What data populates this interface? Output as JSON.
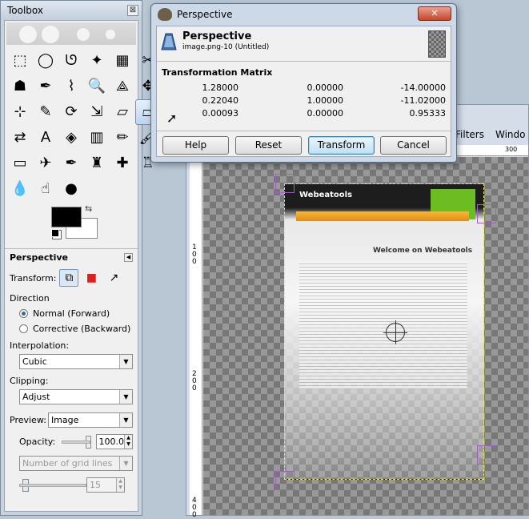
{
  "toolbox": {
    "title": "Toolbox",
    "close_glyph": "⊠",
    "tools": [
      {
        "name": "rect-select-icon",
        "glyph": "⬚"
      },
      {
        "name": "ellipse-select-icon",
        "glyph": "◯"
      },
      {
        "name": "free-select-icon",
        "glyph": "ᘎ"
      },
      {
        "name": "fuzzy-select-icon",
        "glyph": "✦"
      },
      {
        "name": "select-by-color-icon",
        "glyph": "▦"
      },
      {
        "name": "scissors-icon",
        "glyph": "✂"
      },
      {
        "name": "foreground-select-icon",
        "glyph": "☗"
      },
      {
        "name": "paths-icon",
        "glyph": "✒"
      },
      {
        "name": "color-picker-icon",
        "glyph": "⌇"
      },
      {
        "name": "zoom-icon",
        "glyph": "🔍"
      },
      {
        "name": "measure-icon",
        "glyph": "⟁"
      },
      {
        "name": "move-icon",
        "glyph": "✥"
      },
      {
        "name": "align-icon",
        "glyph": "⊹"
      },
      {
        "name": "crop-icon",
        "glyph": "✎"
      },
      {
        "name": "rotate-icon",
        "glyph": "⟳"
      },
      {
        "name": "scale-icon",
        "glyph": "⇲"
      },
      {
        "name": "shear-icon",
        "glyph": "▱"
      },
      {
        "name": "perspective-icon",
        "glyph": "⏢"
      },
      {
        "name": "flip-icon",
        "glyph": "⇄"
      },
      {
        "name": "text-icon",
        "glyph": "A"
      },
      {
        "name": "bucket-fill-icon",
        "glyph": "◈"
      },
      {
        "name": "blend-icon",
        "glyph": "▥"
      },
      {
        "name": "pencil-icon",
        "glyph": "✏"
      },
      {
        "name": "paintbrush-icon",
        "glyph": "🖌"
      },
      {
        "name": "eraser-icon",
        "glyph": "▭"
      },
      {
        "name": "airbrush-icon",
        "glyph": "✈"
      },
      {
        "name": "ink-icon",
        "glyph": "✒"
      },
      {
        "name": "clone-icon",
        "glyph": "♜"
      },
      {
        "name": "heal-icon",
        "glyph": "✚"
      },
      {
        "name": "perspective-clone-icon",
        "glyph": "♖"
      },
      {
        "name": "blur-icon",
        "glyph": "💧"
      },
      {
        "name": "smudge-icon",
        "glyph": "☝"
      },
      {
        "name": "dodge-burn-icon",
        "glyph": "●"
      }
    ],
    "options": {
      "name": "Perspective",
      "transform_label": "Transform:",
      "direction_label": "Direction",
      "direction_options": [
        "Normal (Forward)",
        "Corrective (Backward)"
      ],
      "interpolation_label": "Interpolation:",
      "interpolation_value": "Cubic",
      "clipping_label": "Clipping:",
      "clipping_value": "Adjust",
      "preview_label": "Preview:",
      "preview_value": "Image",
      "opacity_label": "Opacity:",
      "opacity_value": "100.0",
      "grid_value": "Number of grid lines",
      "grid_count": "15"
    }
  },
  "image_window": {
    "menu": [
      "Filters",
      "Windo"
    ],
    "ruler_h": [
      "300"
    ],
    "ruler_v": [
      "1\n0\n0",
      "2\n0\n0",
      "3\n0\n0",
      "4\n0\n0"
    ],
    "web": {
      "logo": "Webeatools",
      "welcome": "Welcome on Webeatools"
    }
  },
  "dialog": {
    "title": "Perspective",
    "close_glyph": "✕",
    "heading": "Perspective",
    "subheading": "image.png-10 (Untitled)",
    "matrix_title": "Transformation Matrix",
    "matrix": [
      [
        "1.28000",
        "0.00000",
        "-14.00000"
      ],
      [
        "0.22040",
        "1.00000",
        "-11.02000"
      ],
      [
        "0.00093",
        "0.00000",
        "0.95333"
      ]
    ],
    "buttons": {
      "help": "Help",
      "reset": "Reset",
      "transform": "Transform",
      "cancel": "Cancel"
    }
  }
}
